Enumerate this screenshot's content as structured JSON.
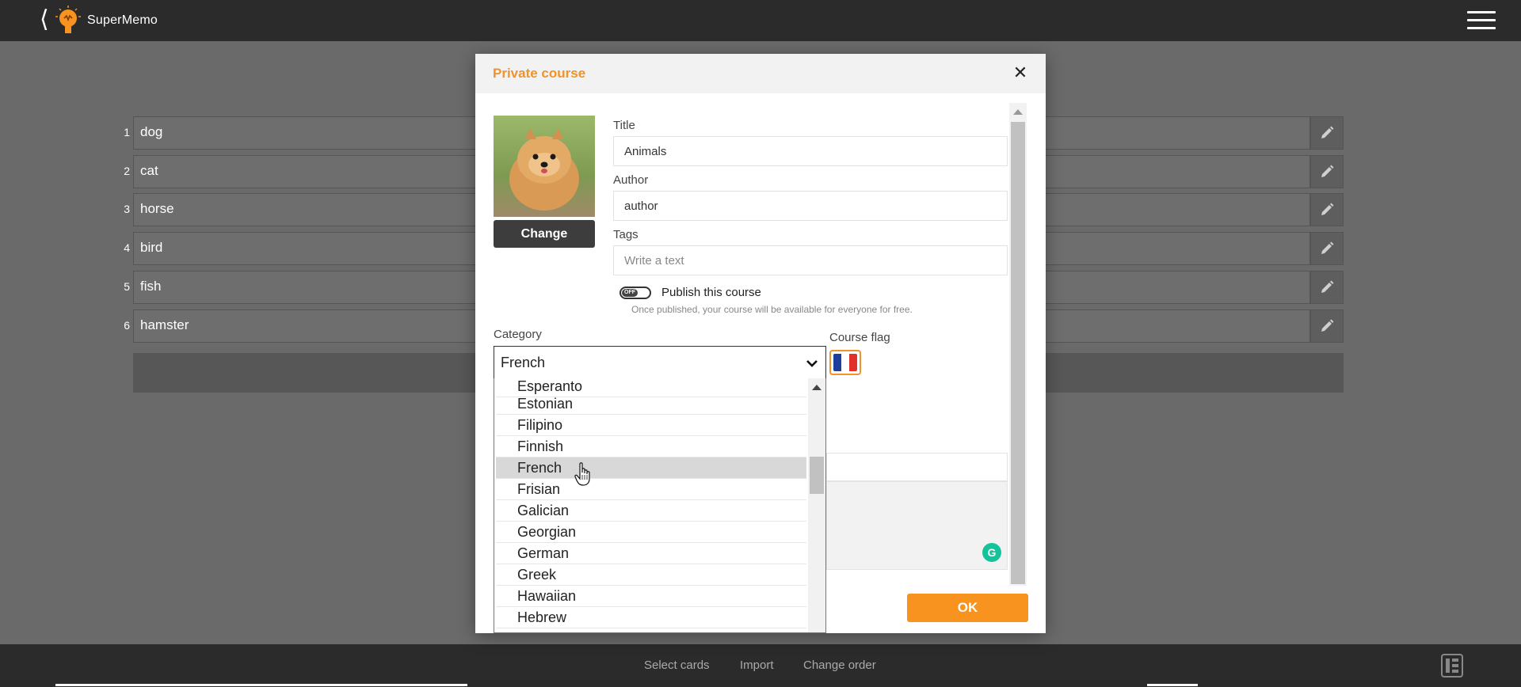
{
  "app": {
    "name": "SuperMemo"
  },
  "course_rows": [
    {
      "num": "1",
      "value": "dog"
    },
    {
      "num": "2",
      "value": "cat"
    },
    {
      "num": "3",
      "value": "horse"
    },
    {
      "num": "4",
      "value": "bird"
    },
    {
      "num": "5",
      "value": "fish"
    },
    {
      "num": "6",
      "value": "hamster"
    }
  ],
  "footer": {
    "select_cards": "Select cards",
    "import": "Import",
    "change_order": "Change order"
  },
  "modal": {
    "title": "Private course",
    "change_button": "Change",
    "title_label": "Title",
    "title_value": "Animals",
    "author_label": "Author",
    "author_value": "author",
    "tags_label": "Tags",
    "tags_placeholder": "Write a text",
    "toggle_state": "OFF",
    "publish_label": "Publish this course",
    "publish_note": "Once published, your course will be available for everyone for free.",
    "category_label": "Category",
    "category_selected": "French",
    "course_flag_label": "Course flag",
    "ok_button": "OK"
  },
  "category_options": [
    "Esperanto",
    "Estonian",
    "Filipino",
    "Finnish",
    "French",
    "Frisian",
    "Galician",
    "Georgian",
    "German",
    "Greek",
    "Hawaiian",
    "Hebrew"
  ],
  "colors": {
    "accent": "#f7931e",
    "title_orange": "#f0932b",
    "flag_blue": "#1d3e9a",
    "flag_white": "#ffffff",
    "flag_red": "#e1312b"
  }
}
